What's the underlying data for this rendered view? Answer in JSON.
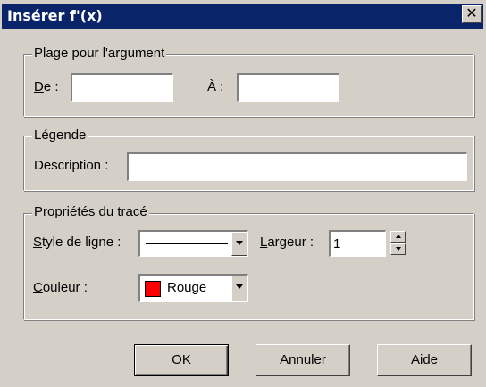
{
  "window": {
    "title": "Insérer f'(x)",
    "close_glyph": "✕"
  },
  "range_group": {
    "legend": "Plage pour l'argument",
    "from_label_mnemonic": "D",
    "from_label_rest": "e :",
    "from_value": "",
    "to_label": "À :",
    "to_value": ""
  },
  "legend_group": {
    "legend": "Légende",
    "description_label": "Description :",
    "description_value": ""
  },
  "plot_group": {
    "legend": "Propriétés du tracé",
    "line_style_label_mnemonic": "S",
    "line_style_label_rest": "tyle de ligne :",
    "line_style_value": "solid",
    "width_label_mnemonic": "L",
    "width_label_rest": "argeur :",
    "width_value": "1",
    "color_label_mnemonic": "C",
    "color_label_rest": "ouleur :",
    "color_name": "Rouge",
    "color_swatch": "#ff0000"
  },
  "buttons": {
    "ok": "OK",
    "cancel": "Annuler",
    "help": "Aide"
  }
}
